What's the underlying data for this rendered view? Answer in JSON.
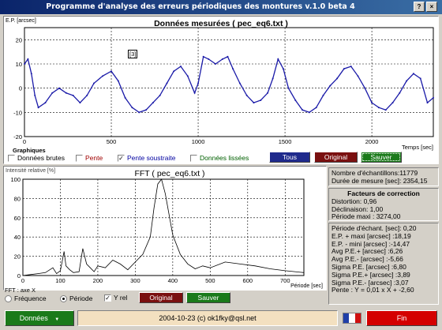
{
  "window": {
    "title": "Programme d'analyse des erreurs périodiques des montures v.1.0 beta 4",
    "help_btn": "?",
    "close_btn": "×"
  },
  "top_chart": {
    "title": "Données mesurées ( pec_eq6.txt )",
    "ylabel": "E.P. [arcsec]",
    "xlabel": "Temps [sec]",
    "marker_label": "[3]"
  },
  "graph_options": {
    "group_label": "Graphiques",
    "raw_label": "Données brutes",
    "slope_label": "Pente",
    "slope_sub_label": "Pente soustraite",
    "smoothed_label": "Données lissées",
    "raw_checked": false,
    "slope_checked": false,
    "slope_sub_checked": true,
    "smoothed_checked": false,
    "all_btn": "Tous",
    "original_btn": "Original",
    "save_btn": "Sauver"
  },
  "fft_chart": {
    "title": "FFT ( pec_eq6.txt )",
    "ylabel": "Intensité relative [%]",
    "xlabel": "Période [sec]",
    "axis_group": "FFT : axe X",
    "freq_label": "Fréquence",
    "period_label": "Période",
    "axis_selected": "period",
    "yrel_label": "Y rel",
    "yrel_checked": true,
    "original_btn": "Original",
    "save_btn": "Sauver"
  },
  "info": {
    "samples": "Nombre d'échantillons:11779",
    "duration": "Durée de mesure [sec]: 2354,15",
    "factors_title": "Facteurs de correction",
    "distortion": "Distortion: 0,96",
    "declination": "Déclinaison: 1,00",
    "max_period": "Période maxi : 3274,00",
    "sampling_period": "Période d'échant. [sec]: 0,20",
    "ep_max": "E.P. + maxi [arcsec] :18,19",
    "ep_min": "E.P. - mini [arcsec] :-14,47",
    "avg_pos": "Avg P.E.+ [arcsec] :6,26",
    "avg_neg": "Avg P.E.- [arcsec] :-5,66",
    "sigma_pe": "Sigma P.E. [arcsec] :6,80",
    "sigma_pos": "Sigma P.E.+ [arcsec] :3,89",
    "sigma_neg": "Sigma P.E.- [arcsec] :3,07",
    "slope": "Pente : Y = 0,01 x X + -2,60"
  },
  "status": {
    "data_btn": "Données",
    "copyright": "2004-10-23 (c) ok1fky@qsl.net",
    "end_btn": "Fin"
  },
  "colors": {
    "titlebar": "#0a246a",
    "plot_line": "#1a1aa8",
    "fft_line": "#000000",
    "blue_btn": "#1f2a8c",
    "red_btn": "#7a1010",
    "green_btn": "#1a7a1a",
    "status_center": "#f3e0c0"
  },
  "chart_data": [
    {
      "type": "line",
      "title": "Données mesurées ( pec_eq6.txt )",
      "xlabel": "Temps [sec]",
      "ylabel": "E.P. [arcsec]",
      "xlim": [
        0,
        2354
      ],
      "ylim": [
        -20,
        25
      ],
      "x_ticks": [
        0,
        500,
        1000,
        1500,
        2000
      ],
      "y_ticks": [
        -20,
        -10,
        0,
        10,
        20
      ],
      "grid": true,
      "series": [
        {
          "x": [
            0,
            20,
            40,
            60,
            80,
            120,
            160,
            200,
            240,
            280,
            320,
            360,
            400,
            450,
            500,
            540,
            580,
            620,
            660,
            700,
            740,
            780,
            820,
            860,
            900,
            940,
            980,
            1000,
            1030,
            1060,
            1100,
            1140,
            1170,
            1200,
            1240,
            1280,
            1320,
            1360,
            1400,
            1430,
            1460,
            1490,
            1520,
            1560,
            1600,
            1640,
            1680,
            1720,
            1760,
            1800,
            1840,
            1880,
            1920,
            1960,
            2000,
            2040,
            2080,
            2120,
            2160,
            2200,
            2240,
            2280,
            2320,
            2354
          ],
          "values": [
            10,
            12,
            6,
            -3,
            -8,
            -6,
            -2,
            0,
            -2,
            -3,
            -6,
            -3,
            2,
            5,
            7,
            3,
            -4,
            -8,
            -10,
            -9,
            -6,
            -3,
            2,
            7,
            9,
            5,
            -2,
            2,
            13,
            12,
            10,
            12,
            13,
            8,
            2,
            -3,
            -6,
            -5,
            -2,
            4,
            12,
            8,
            0,
            -5,
            -9,
            -10,
            -8,
            -3,
            1,
            4,
            8,
            9,
            5,
            0,
            -6,
            -8,
            -9,
            -6,
            -2,
            3,
            6,
            4,
            -6,
            -4
          ]
        }
      ]
    },
    {
      "type": "line",
      "title": "FFT ( pec_eq6.txt )",
      "xlabel": "Période [sec]",
      "ylabel": "Intensité relative [%]",
      "xlim": [
        0,
        750
      ],
      "ylim": [
        0,
        100
      ],
      "x_ticks": [
        0,
        100,
        200,
        300,
        400,
        500,
        600,
        700
      ],
      "y_ticks": [
        0,
        20,
        40,
        60,
        80,
        100
      ],
      "grid": true,
      "series": [
        {
          "x": [
            0,
            20,
            40,
            60,
            80,
            90,
            100,
            110,
            115,
            125,
            135,
            150,
            160,
            170,
            180,
            190,
            200,
            220,
            240,
            260,
            280,
            300,
            320,
            340,
            350,
            360,
            370,
            380,
            400,
            420,
            440,
            460,
            480,
            500,
            540,
            580,
            620,
            660,
            700,
            750
          ],
          "values": [
            0,
            1,
            2,
            3,
            8,
            2,
            5,
            25,
            10,
            6,
            3,
            4,
            28,
            12,
            8,
            4,
            10,
            8,
            16,
            12,
            6,
            14,
            22,
            40,
            70,
            95,
            100,
            85,
            42,
            22,
            12,
            7,
            10,
            8,
            14,
            12,
            10,
            7,
            5,
            3
          ]
        }
      ]
    }
  ]
}
